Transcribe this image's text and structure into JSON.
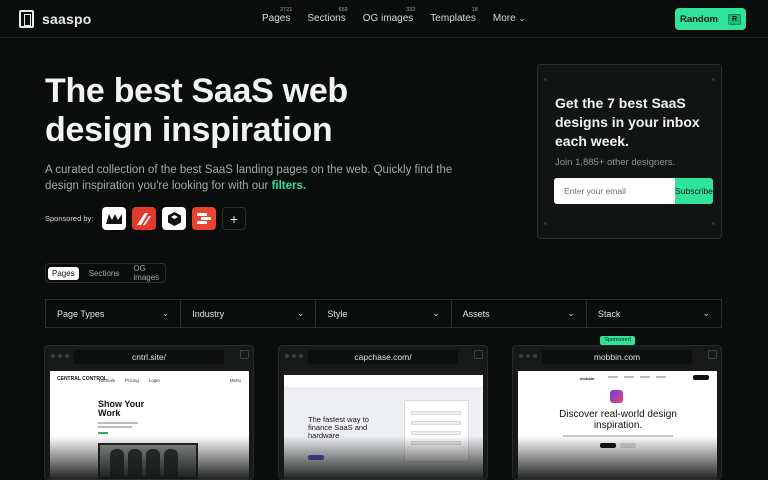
{
  "nav": {
    "logo_text": "saaspo",
    "links": [
      {
        "label": "Pages",
        "count": "2721"
      },
      {
        "label": "Sections",
        "count": "659"
      },
      {
        "label": "OG images",
        "count": "332"
      },
      {
        "label": "Templates",
        "count": "18"
      },
      {
        "label": "More"
      }
    ],
    "random_label": "Random",
    "random_shortcut": "R"
  },
  "hero": {
    "title": "The best SaaS web design inspiration",
    "description": "A curated collection of the best SaaS landing pages on the web. Quickly find the design inspiration you're looking for with our",
    "filters_link": "filters.",
    "sponsored_label": "Sponsored by:",
    "add_sponsor": "+"
  },
  "newsletter": {
    "title": "Get the 7 best SaaS designs in your inbox each week.",
    "subtitle": "Join 1,885+ other designers.",
    "email_placeholder": "Enter your email",
    "subscribe_label": "Subscribe"
  },
  "tabs": [
    {
      "label": "Pages",
      "active": true
    },
    {
      "label": "Sections",
      "active": false
    },
    {
      "label": "OG images",
      "active": false
    }
  ],
  "filters": [
    "Page Types",
    "Industry",
    "Style",
    "Assets",
    "Stack"
  ],
  "cards": [
    {
      "url": "cntrl.site/",
      "preview": {
        "logo": "CENTRAL CONTROL",
        "nav": [
          "Tutorials",
          "Pricing",
          "Login"
        ],
        "nav_right": "Menu",
        "heading": "Show Your Work"
      }
    },
    {
      "url": "capchase.com/",
      "preview": {
        "heading": "The fastest way to finance SaaS and hardware"
      }
    },
    {
      "url": "mobbin.com",
      "sponsored": "Sponsored",
      "preview": {
        "logo": "mobbin",
        "heading": "Discover real-world design inspiration."
      }
    }
  ],
  "colors": {
    "accent": "#2fe39a",
    "background": "#0b0c0c"
  }
}
